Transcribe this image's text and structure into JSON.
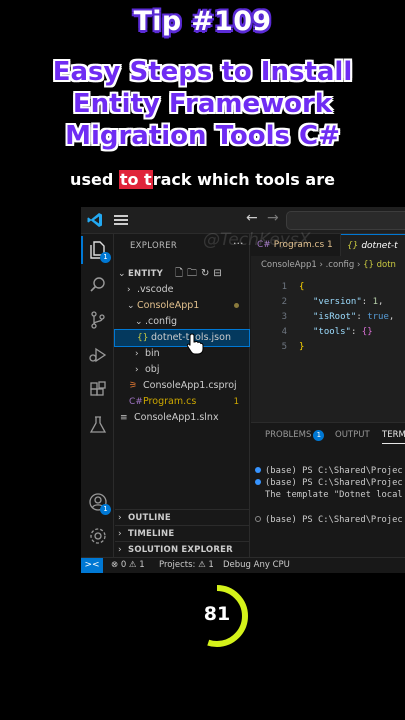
{
  "overlay": {
    "tip": "Tip #109",
    "headline_lines": [
      "Easy Steps to Install",
      "Entity Framework",
      "Migration Tools C#"
    ],
    "caption_pre": "used ",
    "caption_hl": "to t",
    "caption_post": "rack which tools are",
    "watermark": "@TechKeysX",
    "timer_value": "81",
    "timer_fraction": 0.55
  },
  "colors": {
    "tip_outline": "#5b2bd6",
    "headline": "#6f2cf3",
    "caption_highlight": "#e0243a",
    "accent": "#0078d4",
    "timer_ring": "#d4f21a"
  },
  "titlebar": {
    "icons": [
      "vscode-logo-icon",
      "menu-icon",
      "arrow-left-icon",
      "arrow-right-icon"
    ],
    "back": "←",
    "forward": "→"
  },
  "activity": {
    "explorer_badge": "1",
    "icons": [
      "files-icon",
      "search-icon",
      "source-control-icon",
      "run-debug-icon",
      "extensions-icon",
      "testing-icon",
      "account-icon",
      "settings-gear-icon"
    ]
  },
  "explorer": {
    "title": "EXPLORER",
    "more": "···",
    "root": "ENTITY",
    "items": [
      {
        "label": ".vscode",
        "type": "folder",
        "collapsed": true
      },
      {
        "label": "ConsoleApp1",
        "type": "folder",
        "collapsed": false,
        "color": "#e2c08d"
      },
      {
        "label": ".config",
        "type": "folder",
        "collapsed": false
      },
      {
        "label": "dotnet-tools.json",
        "type": "json"
      },
      {
        "label": "bin",
        "type": "folder",
        "collapsed": true
      },
      {
        "label": "obj",
        "type": "folder",
        "collapsed": true
      },
      {
        "label": "ConsoleApp1.csproj",
        "type": "xml"
      },
      {
        "label": "Program.cs",
        "type": "cs",
        "problems": "1"
      },
      {
        "label": "ConsoleApp1.slnx",
        "type": "sln"
      }
    ],
    "sections": [
      "OUTLINE",
      "TIMELINE",
      "SOLUTION EXPLORER"
    ]
  },
  "editor": {
    "tabs": [
      "Program.cs 1",
      "dotnet-t"
    ],
    "breadcrumb": [
      "ConsoleApp1",
      ".config",
      "{} dotn"
    ],
    "lines": [
      {
        "n": "1",
        "text": "{"
      },
      {
        "n": "2",
        "key": "\"version\"",
        "value": "1"
      },
      {
        "n": "3",
        "key": "\"isRoot\"",
        "value": "true"
      },
      {
        "n": "4",
        "key": "\"tools\"",
        "value": "{}"
      },
      {
        "n": "5",
        "text": "}"
      }
    ]
  },
  "panel": {
    "tabs": [
      "PROBLEMS",
      "OUTPUT",
      "TERMI"
    ],
    "problems_count": "1",
    "terminal_lines": [
      "(base) PS C:\\Shared\\Projec",
      "(base) PS C:\\Shared\\Projec",
      "The template \"Dotnet local",
      "(base) PS C:\\Shared\\Projec"
    ]
  },
  "status": {
    "remote": "><",
    "problems": "⊗ 0 ⚠ 1",
    "projects": "Projects: ⚠ 1",
    "debug": "Debug Any CPU"
  }
}
